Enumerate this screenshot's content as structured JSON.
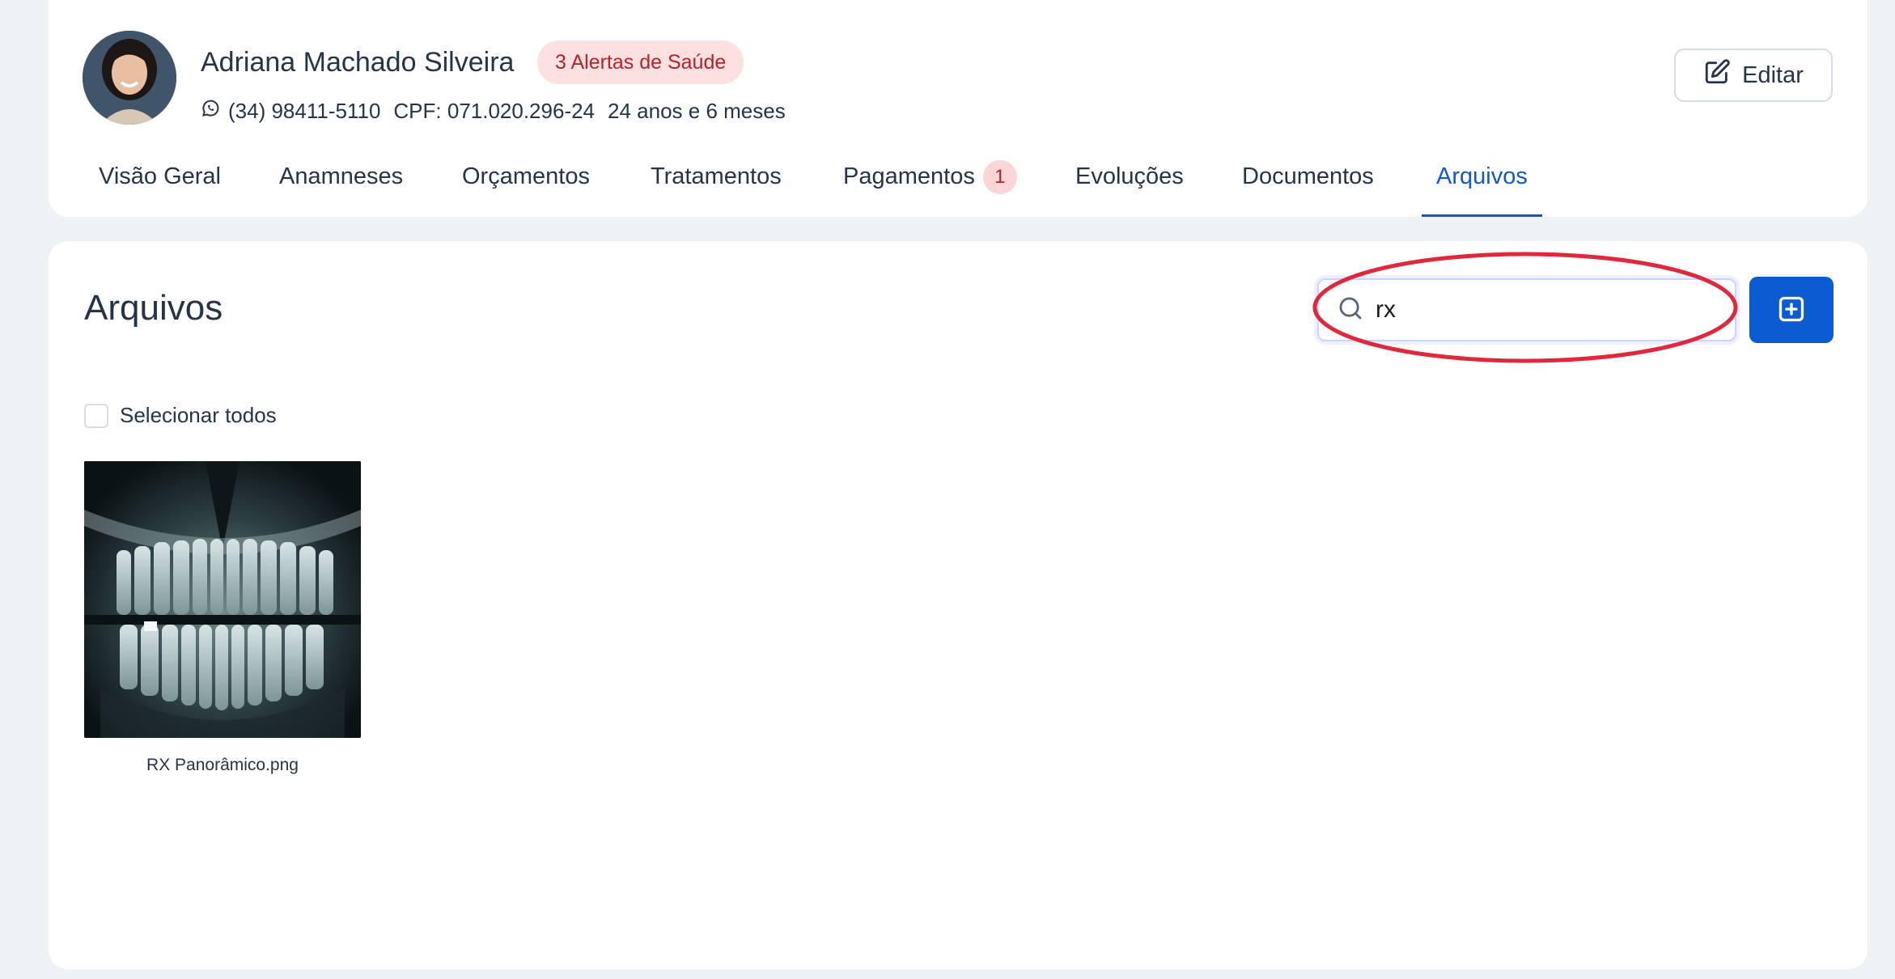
{
  "patient": {
    "name": "Adriana Machado Silveira",
    "alert_badge": "3 Alertas de Saúde",
    "phone": "(34) 98411-5110",
    "cpf": "CPF: 071.020.296-24",
    "age": "24 anos e 6 meses",
    "edit_label": "Editar"
  },
  "tabs": [
    {
      "label": "Visão Geral"
    },
    {
      "label": "Anamneses"
    },
    {
      "label": "Orçamentos"
    },
    {
      "label": "Tratamentos"
    },
    {
      "label": "Pagamentos",
      "badge": "1"
    },
    {
      "label": "Evoluções"
    },
    {
      "label": "Documentos"
    },
    {
      "label": "Arquivos",
      "active": true
    }
  ],
  "files": {
    "title": "Arquivos",
    "search_value": "rx",
    "select_all_label": "Selecionar todos",
    "items": [
      {
        "name": "RX Panorâmico.png",
        "icon": "xray-image"
      }
    ]
  },
  "icons": {
    "phone": "whatsapp-icon",
    "edit": "edit-icon",
    "search": "search-icon",
    "add": "plus-square-icon"
  },
  "colors": {
    "accent": "#0b5bd3",
    "active_tab": "#1458c4",
    "alert_bg": "#fde0e0",
    "alert_text": "#b4232a",
    "annotation": "#e0283c"
  }
}
